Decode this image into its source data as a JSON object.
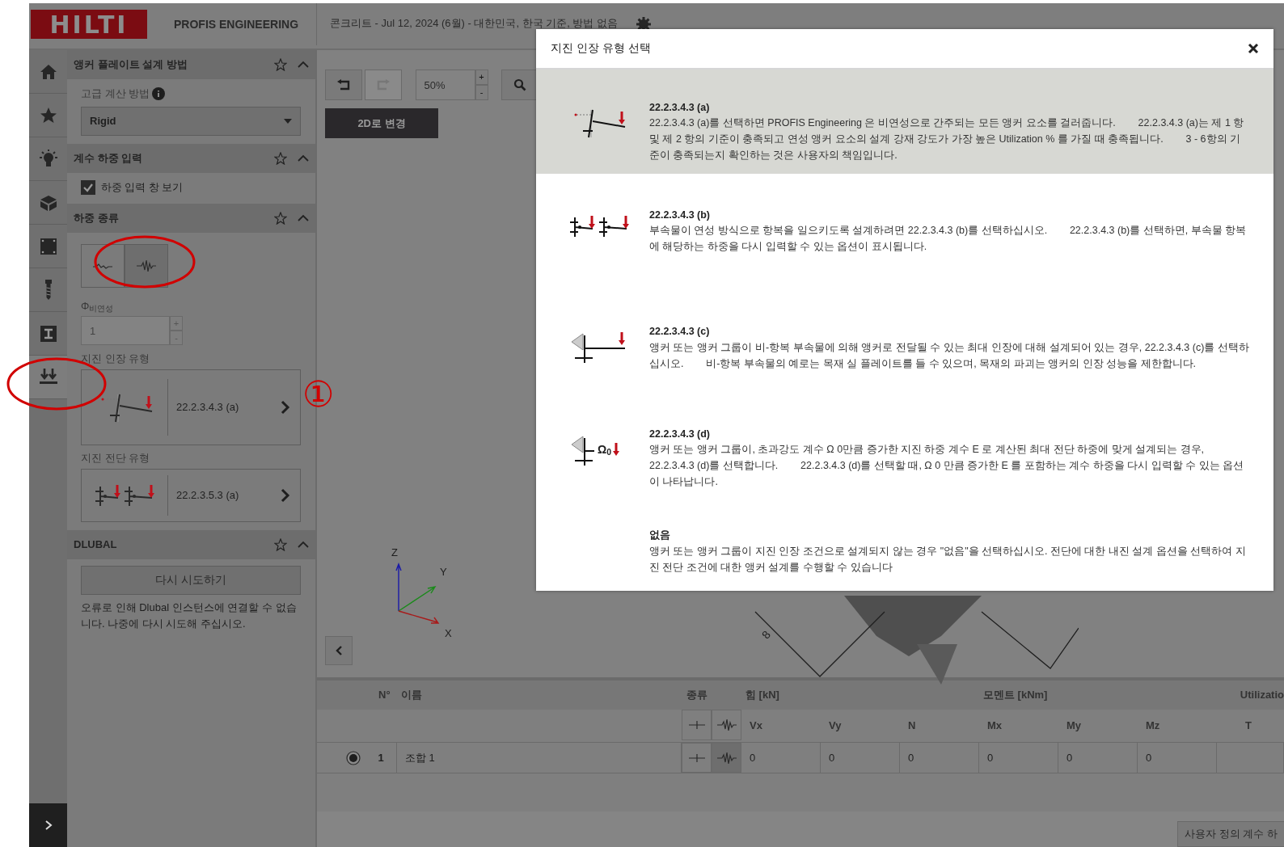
{
  "header": {
    "logo": "HILTI",
    "product": "PROFIS ENGINEERING",
    "project": "콘크리트 - Jul 12, 2024 (6월) - 대한민국, 한국 기준, 방법 없음"
  },
  "sidebar": {
    "items": [
      {
        "kind": "home",
        "selected": false
      },
      {
        "kind": "star",
        "selected": false
      },
      {
        "kind": "bulb",
        "selected": false
      },
      {
        "kind": "box",
        "selected": false
      },
      {
        "kind": "plate",
        "selected": false
      },
      {
        "kind": "anchor",
        "selected": false
      },
      {
        "kind": "profile",
        "selected": false
      },
      {
        "kind": "loads",
        "selected": true
      }
    ]
  },
  "panel": {
    "sections": [
      {
        "kind": "method",
        "title": "앵커 플레이트 설계 방법",
        "label": "고급 계산 방법",
        "value": "Rigid"
      },
      {
        "kind": "check",
        "title": "계수 하중 입력",
        "label": "하중 입력 창 보기",
        "checked": true
      },
      {
        "kind": "loadtype",
        "title": "하중 종류",
        "toggles": [
          {
            "kind": "static",
            "selected": false
          },
          {
            "kind": "seismic",
            "selected": true
          }
        ],
        "phi_label": "Φ$_{비연성}$",
        "phi_value": "1",
        "tension_label": "지진 인장 유형",
        "tension_value": "22.2.3.4.3 (a)",
        "shear_label": "지진 전단 유형",
        "shear_value": "22.2.3.5.3 (a)"
      },
      {
        "kind": "dlubal",
        "title": "DLUBAL",
        "button": "다시 시도하기",
        "message": "오류로 인해 Dlubal 인스턴스에 연결할 수 없습니다. 나중에 다시 시도해 주십시오."
      }
    ]
  },
  "canvas": {
    "zoom": "50%",
    "plus": "+",
    "minus": "-",
    "mode_button": "2D로 변경",
    "axes": [
      "Z",
      "Y",
      "X"
    ],
    "dimension": "8"
  },
  "table": {
    "headers": [
      "N°",
      "이름",
      "종류",
      "힘 [kN]",
      "모멘트 [kNm]",
      "Utilizatio"
    ],
    "subheaders": [
      "Vx",
      "Vy",
      "N",
      "Mx",
      "My",
      "Mz",
      "T"
    ],
    "rows": [
      {
        "selected": true,
        "number": "1",
        "name": "조합 1",
        "types": [
          {
            "kind": "static",
            "selected": false
          },
          {
            "kind": "seismic",
            "selected": true
          }
        ],
        "values": [
          "0",
          "0",
          "0",
          "0",
          "0",
          "0"
        ]
      }
    ],
    "footer_button": "사용자 정의 계수 하"
  },
  "modal": {
    "title": "지진 인장 유형 선택",
    "options": [
      {
        "kind": "a",
        "selected": true,
        "code": "22.2.3.4.3 (a)",
        "description": "22.2.3.4.3 (a)를 선택하면 PROFIS Engineering 은 비연성으로 간주되는 모든 앵커 요소를 걸러줍니다.        22.2.3.4.3 (a)는 제 1 항 및 제 2 항의 기준이 충족되고 연성 앵커 요소의 설계 강재 강도가 가장 높은 Utilization % 를 가질 때 충족됩니다.        3 - 6항의 기준이 충족되는지 확인하는 것은 사용자의 책임입니다."
      },
      {
        "kind": "b",
        "selected": false,
        "code": "22.2.3.4.3 (b)",
        "description": "부속물이 연성 방식으로 항복을 일으키도록 설계하려면 22.2.3.4.3 (b)를 선택하십시오.        22.2.3.4.3 (b)를 선택하면, 부속물 항복에 해당하는 하중을 다시 입력할 수 있는 옵션이 표시됩니다."
      },
      {
        "kind": "c",
        "selected": false,
        "code": "22.2.3.4.3 (c)",
        "description": "앵커 또는 앵커 그룹이 비-항복 부속물에 의해 앵커로 전달될 수 있는 최대 인장에 대해 설계되어 있는 경우, 22.2.3.4.3 (c)를 선택하십시오.        비-항복 부속물의 예로는 목재 실 플레이트를 들 수 있으며, 목재의 파괴는 앵커의 인장 성능을 제한합니다."
      },
      {
        "kind": "d",
        "selected": false,
        "code": "22.2.3.4.3 (d)",
        "icon_label": "Ω$_{0}$",
        "description": "앵커 또는 앵커 그룹이, 초과강도 계수 Ω 0만큼 증가한 지진 하중 계수 E 로 계산된 최대 전단 하중에 맞게 설계되는 경우, 22.2.3.4.3 (d)를 선택합니다.        22.2.3.4.3 (d)를 선택할 때, Ω 0 만큼 증가한 E 를 포함하는 계수 하중을 다시 입력할 수 있는 옵션이 나타납니다."
      },
      {
        "kind": "none",
        "selected": false,
        "code": "없음",
        "description": "앵커 또는 앵커 그룹이 지진 인장 조건으로 설계되지 않는 경우 \"없음\"을 선택하십시오. 전단에 대한 내진 설계 옵션을 선택하여 지진 전단 조건에 대한 앵커 설계를 수행할 수 있습니다"
      }
    ]
  },
  "annotations": [
    {
      "kind": "circle"
    },
    {
      "kind": "circle"
    },
    {
      "kind": "number",
      "text": "①"
    }
  ]
}
